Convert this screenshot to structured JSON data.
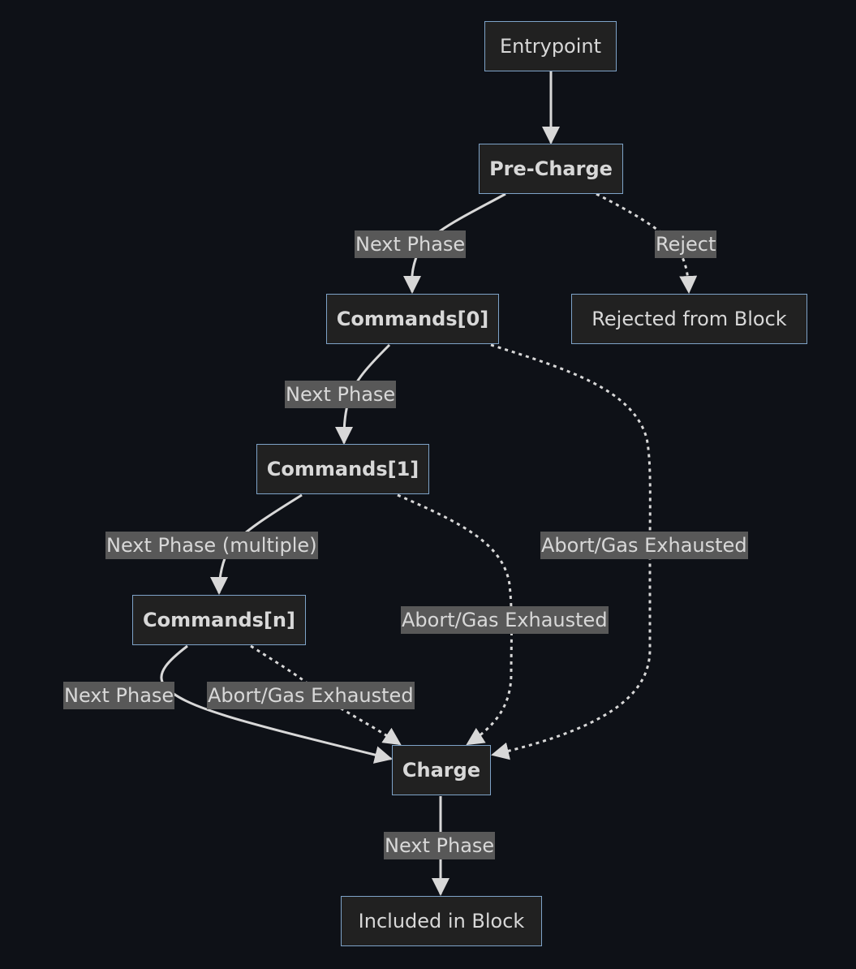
{
  "colors": {
    "background": "#0e1117",
    "node_fill": "#212121",
    "node_border": "#7ea3c8",
    "text": "#d8d8d8",
    "edge": "#d8d8d8",
    "edge_label_bg": "#585858"
  },
  "nodes": {
    "entrypoint": "Entrypoint",
    "precharge": "Pre-Charge",
    "commands0": "Commands[0]",
    "rejected": "Rejected from Block",
    "commands1": "Commands[1]",
    "commandsn": "Commands[n]",
    "charge": "Charge",
    "included": "Included in Block"
  },
  "edges": [
    {
      "from": "entrypoint",
      "to": "precharge",
      "label": "",
      "style": "solid"
    },
    {
      "from": "precharge",
      "to": "commands0",
      "label": "Next Phase",
      "style": "solid"
    },
    {
      "from": "precharge",
      "to": "rejected",
      "label": "Reject",
      "style": "dotted"
    },
    {
      "from": "commands0",
      "to": "commands1",
      "label": "Next Phase",
      "style": "solid"
    },
    {
      "from": "commands0",
      "to": "charge",
      "label": "Abort/Gas Exhausted",
      "style": "dotted"
    },
    {
      "from": "commands1",
      "to": "commandsn",
      "label": "Next Phase (multiple)",
      "style": "solid"
    },
    {
      "from": "commands1",
      "to": "charge",
      "label": "Abort/Gas Exhausted",
      "style": "dotted"
    },
    {
      "from": "commandsn",
      "to": "charge",
      "label": "Next Phase",
      "style": "solid"
    },
    {
      "from": "commandsn",
      "to": "charge",
      "label": "Abort/Gas Exhausted",
      "style": "dotted"
    },
    {
      "from": "charge",
      "to": "included",
      "label": "Next Phase",
      "style": "solid"
    }
  ]
}
